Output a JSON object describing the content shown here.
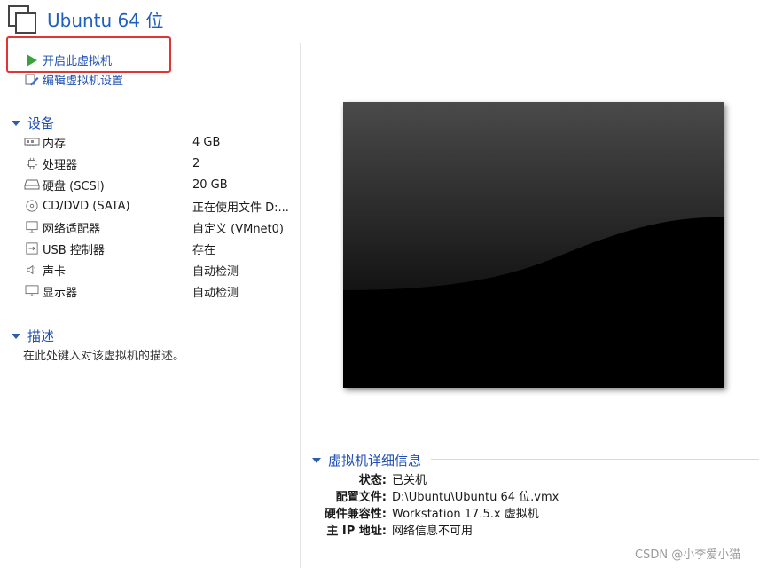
{
  "header": {
    "title": "Ubuntu 64 位"
  },
  "commands": {
    "power_on": "开启此虚拟机",
    "edit_settings": "编辑虚拟机设置"
  },
  "devices": {
    "heading": "设备",
    "items": [
      {
        "icon": "memory-icon",
        "name": "内存",
        "value": "4 GB"
      },
      {
        "icon": "cpu-icon",
        "name": "处理器",
        "value": "2"
      },
      {
        "icon": "hard-disk-icon",
        "name": "硬盘 (SCSI)",
        "value": "20 GB"
      },
      {
        "icon": "cd-dvd-icon",
        "name": "CD/DVD (SATA)",
        "value": "正在使用文件 D:..."
      },
      {
        "icon": "network-adapter-icon",
        "name": "网络适配器",
        "value": "自定义 (VMnet0)"
      },
      {
        "icon": "usb-icon",
        "name": "USB 控制器",
        "value": "存在"
      },
      {
        "icon": "speaker-icon",
        "name": "声卡",
        "value": "自动检测"
      },
      {
        "icon": "monitor-icon",
        "name": "显示器",
        "value": "自动检测"
      }
    ]
  },
  "description": {
    "heading": "描述",
    "placeholder": "在此处键入对该虚拟机的描述。"
  },
  "details": {
    "heading": "虚拟机详细信息",
    "rows": [
      {
        "key": "状态:",
        "value": "已关机"
      },
      {
        "key": "配置文件:",
        "value": "D:\\Ubuntu\\Ubuntu 64 位.vmx"
      },
      {
        "key": "硬件兼容性:",
        "value": "Workstation 17.5.x 虚拟机"
      },
      {
        "key": "主 IP 地址:",
        "value": "网络信息不可用"
      }
    ]
  },
  "watermark": "CSDN @小李爱小猫",
  "colors": {
    "accent": "#1e4fb2",
    "play": "#3aa23a",
    "highlight": "#e33333"
  }
}
